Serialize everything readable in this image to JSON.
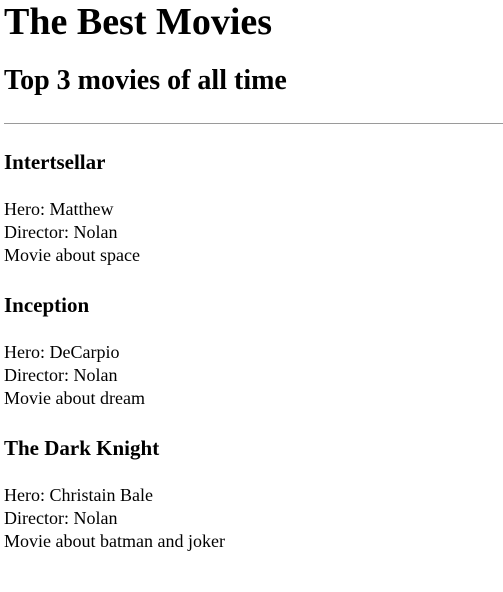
{
  "header": {
    "title": "The Best Movies",
    "subtitle": "Top 3 movies of all time"
  },
  "movies": [
    {
      "title": "Intertsellar",
      "hero": "Hero: Matthew",
      "director": "Director: Nolan",
      "description": "Movie about space"
    },
    {
      "title": "Inception",
      "hero": "Hero: DeCarpio",
      "director": "Director: Nolan",
      "description": "Movie about dream"
    },
    {
      "title": "The Dark Knight",
      "hero": "Hero: Christain Bale",
      "director": "Director: Nolan",
      "description": "Movie about batman and joker"
    }
  ]
}
